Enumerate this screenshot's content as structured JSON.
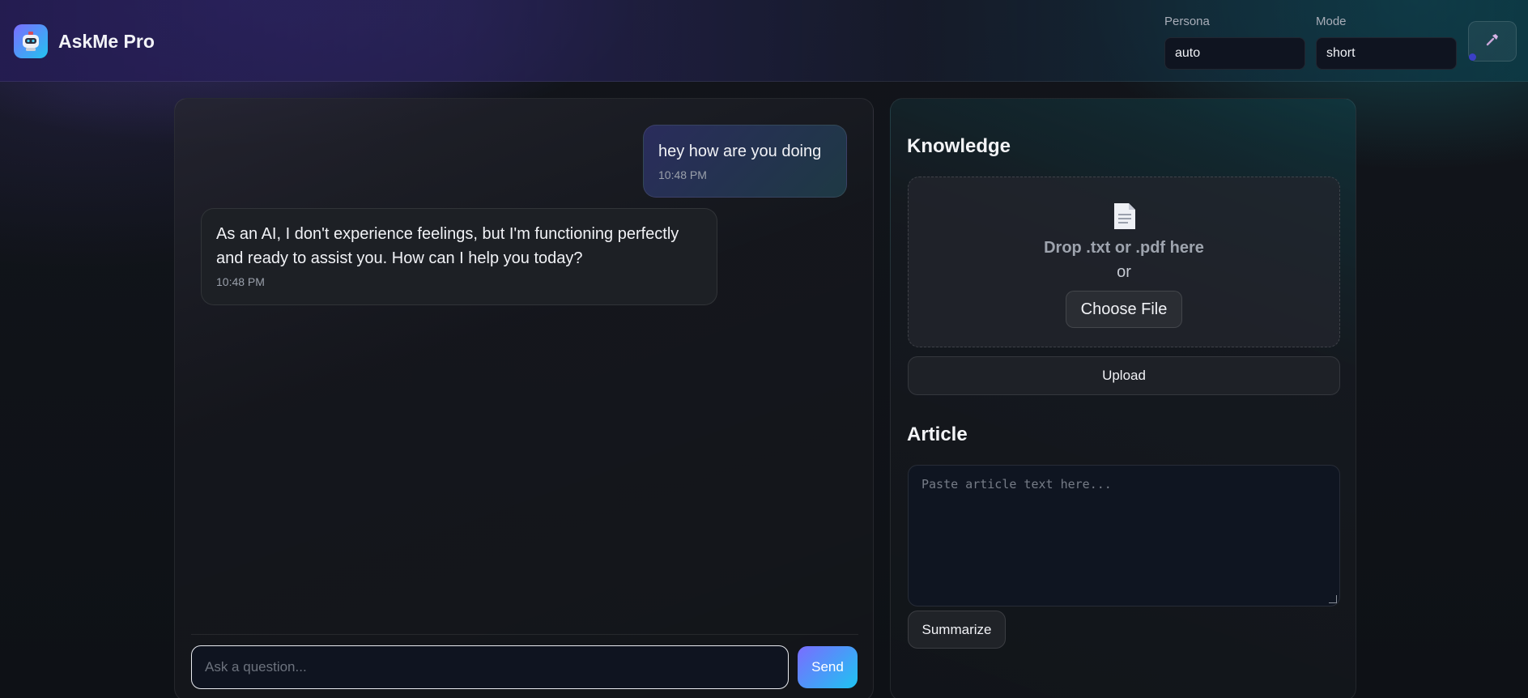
{
  "app": {
    "title": "AskMe Pro",
    "logo_icon": "robot-icon"
  },
  "header": {
    "persona": {
      "label": "Persona",
      "value": "auto"
    },
    "mode": {
      "label": "Mode",
      "value": "short"
    },
    "tool_icon": "hammer-icon"
  },
  "chat": {
    "messages": [
      {
        "role": "user",
        "text": "hey how are you doing",
        "time": "10:48 PM"
      },
      {
        "role": "assistant",
        "text": "As an AI, I don't experience feelings, but I'm functioning perfectly and ready to assist you. How can I help you today?",
        "time": "10:48 PM"
      }
    ],
    "input_placeholder": "Ask a question...",
    "send_label": "Send"
  },
  "knowledge": {
    "title": "Knowledge",
    "drop_text": "Drop .txt or .pdf here",
    "or_text": "or",
    "choose_label": "Choose File",
    "upload_label": "Upload",
    "file_icon": "document-icon"
  },
  "article": {
    "title": "Article",
    "placeholder": "Paste article text here...",
    "summarize_label": "Summarize"
  },
  "colors": {
    "accent_start": "#7a6cff",
    "accent_end": "#1ec4f2",
    "background": "#0f1217"
  }
}
